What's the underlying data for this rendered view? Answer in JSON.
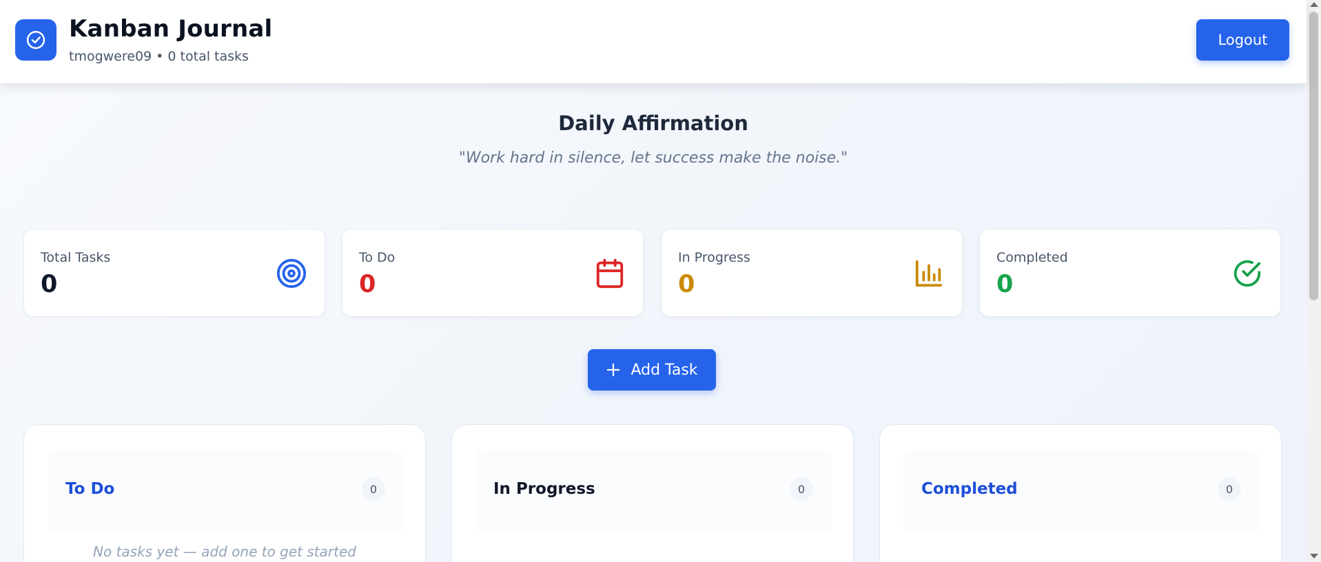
{
  "header": {
    "title": "Kanban Journal",
    "subtitle": "tmogwere09 • 0 total tasks",
    "logout_label": "Logout",
    "logo_icon": "check-circle-icon"
  },
  "affirmation": {
    "title": "Daily Affirmation",
    "quote": "\"Work hard in silence, let success make the noise.\""
  },
  "stats": [
    {
      "label": "Total Tasks",
      "value": "0",
      "color": "#0f172a",
      "icon": "target-icon",
      "icon_color": "#2563eb"
    },
    {
      "label": "To Do",
      "value": "0",
      "color": "#dc2626",
      "icon": "calendar-icon",
      "icon_color": "#dc2626"
    },
    {
      "label": "In Progress",
      "value": "0",
      "color": "#ca8a04",
      "icon": "bar-chart-icon",
      "icon_color": "#ca8a04"
    },
    {
      "label": "Completed",
      "value": "0",
      "color": "#16a34a",
      "icon": "check-circle-icon",
      "icon_color": "#16a34a"
    }
  ],
  "add_task": {
    "label": "Add Task",
    "icon": "plus-icon"
  },
  "columns": [
    {
      "title": "To Do",
      "count": "0",
      "title_color": "#1d4ed8",
      "empty_text": "No tasks yet — add one to get started"
    },
    {
      "title": "In Progress",
      "count": "0",
      "title_color": "#0f172a"
    },
    {
      "title": "Completed",
      "count": "0",
      "title_color": "#1d4ed8"
    }
  ],
  "colors": {
    "accent": "#2563eb",
    "background": "#f5f7fb"
  }
}
